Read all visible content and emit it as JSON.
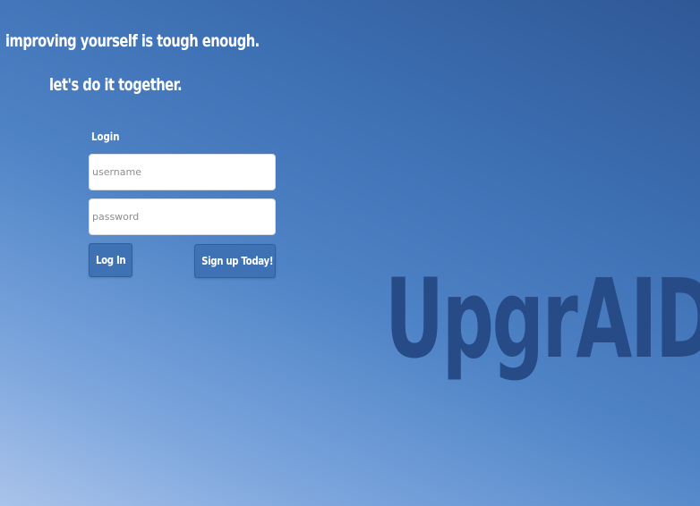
{
  "hero": {
    "line1": "improving yourself is tough enough.",
    "line2": "let's do it together."
  },
  "login": {
    "heading": "Login",
    "username_placeholder": "username",
    "username_value": "",
    "password_placeholder": "password",
    "password_value": "",
    "login_button": "Log In",
    "signup_button": "Sign up Today!"
  },
  "brand": {
    "name": "UpgrAID"
  },
  "colors": {
    "background_top": "#2f5896",
    "background_bottom": "#a9c3ea",
    "button": "#3f72b5",
    "brand_text": "#274b86"
  }
}
